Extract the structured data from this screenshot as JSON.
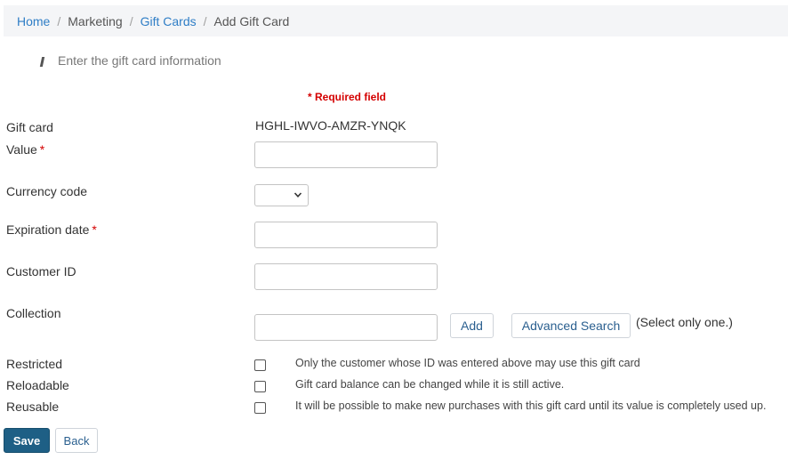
{
  "breadcrumb": {
    "home": "Home",
    "marketing": "Marketing",
    "gift_cards": "Gift Cards",
    "current": "Add Gift Card",
    "separator": "/"
  },
  "section": {
    "heading": "Enter the gift card information"
  },
  "required_note": "* Required field",
  "form": {
    "gift_card": {
      "label": "Gift card",
      "value": "HGHL-IWVO-AMZR-YNQK"
    },
    "value": {
      "label": "Value",
      "required_mark": "*",
      "input_value": ""
    },
    "currency_code": {
      "label": "Currency code",
      "selected": ""
    },
    "expiration_date": {
      "label": "Expiration date",
      "required_mark": "*",
      "input_value": ""
    },
    "customer_id": {
      "label": "Customer ID",
      "input_value": ""
    },
    "collection": {
      "label": "Collection",
      "input_value": "",
      "add_label": "Add",
      "advanced_search_label": "Advanced Search",
      "hint": "(Select only one.)"
    },
    "restricted": {
      "label": "Restricted",
      "checked": false,
      "description": "Only the customer whose ID was entered above may use this gift card"
    },
    "reloadable": {
      "label": "Reloadable",
      "checked": false,
      "description": "Gift card balance can be changed while it is still active."
    },
    "reusable": {
      "label": "Reusable",
      "checked": false,
      "description": "It will be possible to make new purchases with this gift card until its value is completely used up."
    }
  },
  "actions": {
    "save_label": "Save",
    "back_label": "Back"
  },
  "colors": {
    "link": "#2f7ec6",
    "required": "#d40000",
    "primary_button": "#1e5f85",
    "breadcrumb_bg": "#f4f5f7"
  }
}
